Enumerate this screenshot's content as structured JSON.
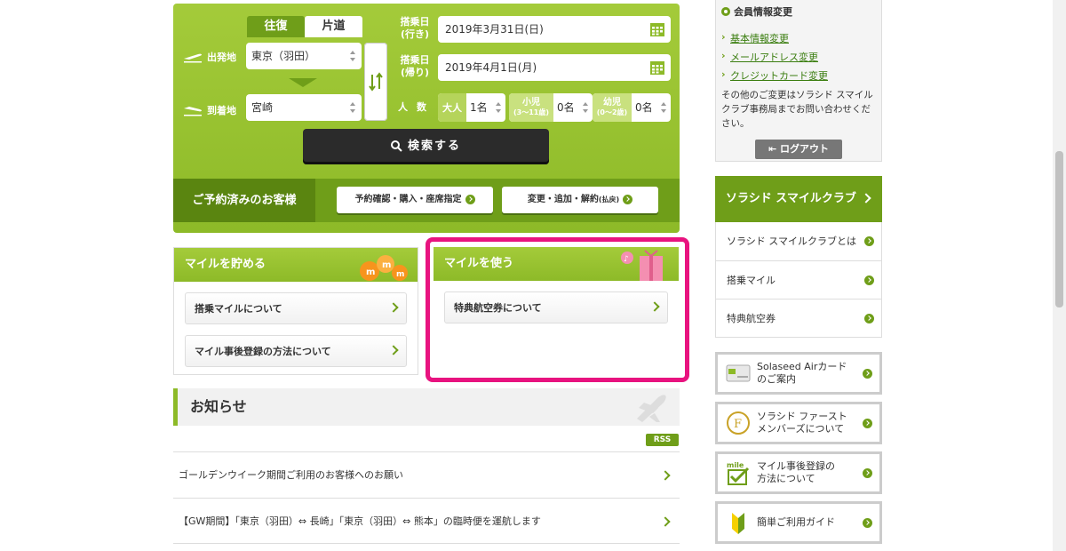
{
  "search": {
    "tabs": [
      "往復",
      "片道"
    ],
    "departure_label": "出発地",
    "arrival_label": "到着地",
    "departure_value": "東京（羽田）",
    "arrival_value": "宮崎",
    "outbound_label_1": "搭乗日",
    "outbound_label_2": "(行き)",
    "outbound_date": "2019年3月31日(日)",
    "return_label_1": "搭乗日",
    "return_label_2": "(帰り)",
    "return_date": "2019年4月1日(月)",
    "pax_label": "人数",
    "adult_label": "大人",
    "adult_value": "1名",
    "child_label": "小児",
    "child_sub": "(3〜11歳)",
    "child_value": "0名",
    "infant_label": "幼児",
    "infant_sub": "(0〜2歳)",
    "infant_value": "0名",
    "search_button": "検索する"
  },
  "reserved": {
    "label": "ご予約済みのお客様",
    "btn_confirm": "予約確認・購入・座席指定",
    "btn_change": "変更・追加・解約",
    "btn_change_sub": "(払戻)"
  },
  "miles_earn": {
    "title": "マイルを貯める",
    "items": [
      "搭乗マイルについて",
      "マイル事後登録の方法について"
    ]
  },
  "miles_use": {
    "title": "マイルを使う",
    "items": [
      "特典航空券について"
    ]
  },
  "news": {
    "title": "お知らせ",
    "rss": "RSS",
    "items": [
      "ゴールデンウイーク期間ご利用のお客様へのお願い",
      "【GW期間】「東京（羽田）⇔ 長崎」「東京（羽田）⇔ 熊本」の臨時便を運航します"
    ]
  },
  "member": {
    "title": "会員情報変更",
    "links": [
      "基本情報変更",
      "メールアドレス変更",
      "クレジットカード変更"
    ],
    "note": "その他のご変更はソラシド スマイルクラブ事務局までお問い合わせください。",
    "logout": "ログアウト"
  },
  "club": {
    "title": "ソラシド スマイルクラブ",
    "items": [
      "ソラシド スマイルクラブとは",
      "搭乗マイル",
      "特典航空券"
    ]
  },
  "banners": [
    {
      "line1": "Solaseed Airカード",
      "line2": "のご案内"
    },
    {
      "line1": "ソラシド ファースト",
      "line2": "メンバーズについて"
    },
    {
      "line1": "マイル事後登録の",
      "line2": "方法について"
    },
    {
      "line1": "簡単ご利用ガイド",
      "line2": ""
    }
  ],
  "colors": {
    "accent_green": "#8dba28",
    "dark_green": "#6f9e19",
    "highlight_pink": "#e8137f"
  }
}
